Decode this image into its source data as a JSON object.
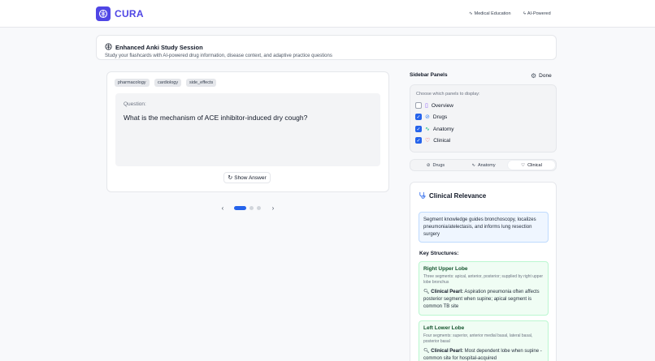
{
  "brand": {
    "name": "CURA",
    "accent": "#4f46e5"
  },
  "header": {
    "badges": [
      {
        "icon": "activity-icon",
        "label": "Medical Education"
      },
      {
        "icon": "sparkle-icon",
        "label": "AI-Powered"
      }
    ]
  },
  "session": {
    "title": "Enhanced Anki Study Session",
    "subtitle": "Study your flashcards with AI-powered drug information, disease context, and adaptive practice questions"
  },
  "card": {
    "tags": [
      "pharmacology",
      "cardiology",
      "side_effects"
    ],
    "question_label": "Question:",
    "question": "What is the mechanism of ACE inhibitor-induced dry cough?",
    "show_answer_label": "Show Answer",
    "pagination": {
      "current": 1,
      "total": 3
    }
  },
  "sidebar": {
    "title": "Sidebar Panels",
    "done_label": "Done",
    "choose_label": "Choose which panels to display:",
    "panels": [
      {
        "label": "Overview",
        "checked": false,
        "icon": "book-icon",
        "color": "#8b5cf6"
      },
      {
        "label": "Drugs",
        "checked": true,
        "icon": "pill-icon",
        "color": "#3b82f6"
      },
      {
        "label": "Anatomy",
        "checked": true,
        "icon": "activity-icon",
        "color": "#10b981"
      },
      {
        "label": "Clinical",
        "checked": true,
        "icon": "stethoscope-icon",
        "color": "#ef4444"
      }
    ],
    "tabs": [
      {
        "label": "Drugs",
        "active": false
      },
      {
        "label": "Anatomy",
        "active": false
      },
      {
        "label": "Clinical",
        "active": true
      }
    ]
  },
  "clinical": {
    "title": "Clinical Relevance",
    "description": "Segment knowledge guides bronchoscopy, localizes pneumonia/atelectasis, and informs lung resection surgery",
    "key_structures_label": "Key Structures:",
    "pearl_label": "Clinical Pearl:",
    "structures": [
      {
        "name": "Right Upper Lobe",
        "desc": "Three segments: apical, anterior, posterior; supplied by right upper lobe bronchus",
        "pearl": "Aspiration pneumonia often affects posterior segment when supine; apical segment is common TB site"
      },
      {
        "name": "Left Lower Lobe",
        "desc": "Four segments: superior, anterior medial basal, lateral basal, posterior basal",
        "pearl": "Most dependent lobe when supine - common site for hospital-acquired"
      }
    ]
  }
}
